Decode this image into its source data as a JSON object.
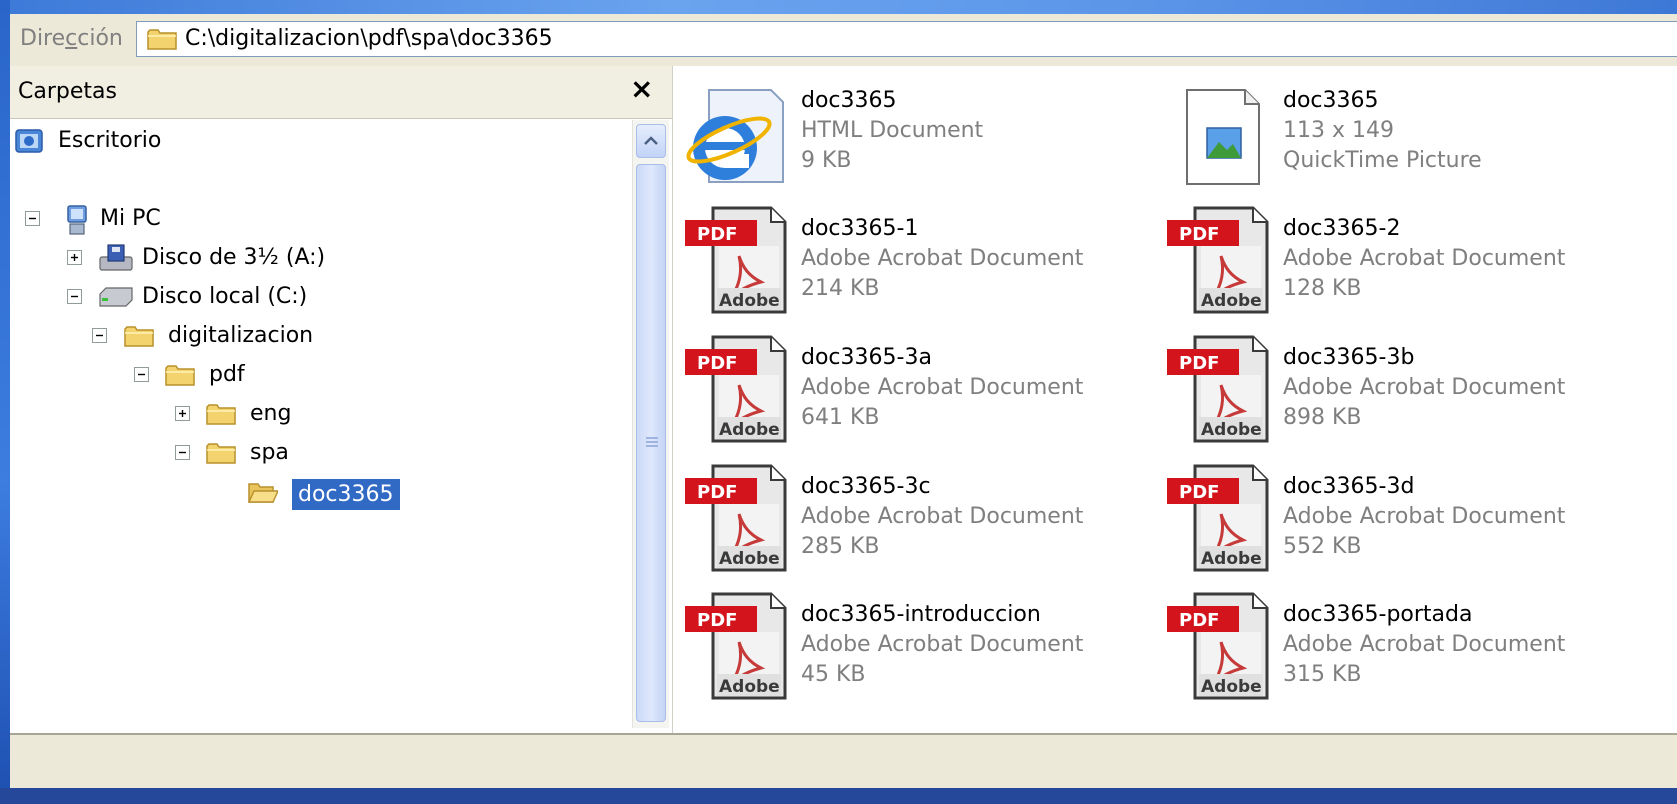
{
  "address_bar": {
    "label_prefix": "Dire",
    "label_underlined": "c",
    "label_suffix": "ción",
    "path": "C:\\digitalizacion\\pdf\\spa\\doc3365"
  },
  "folders_pane": {
    "title": "Carpetas",
    "close_glyph": "×",
    "tree": [
      {
        "label": "Escritorio",
        "icon": "desktop-icon"
      },
      {
        "label": "Mi PC",
        "icon": "my-computer-icon",
        "toggle": "collapse"
      },
      {
        "label": "Disco de 3½ (A:)",
        "icon": "floppy-drive-icon",
        "toggle": "expand"
      },
      {
        "label": "Disco local (C:)",
        "icon": "hard-drive-icon",
        "toggle": "collapse"
      },
      {
        "label": "digitalizacion",
        "icon": "folder-icon",
        "toggle": "collapse"
      },
      {
        "label": "pdf",
        "icon": "folder-icon",
        "toggle": "collapse"
      },
      {
        "label": "eng",
        "icon": "folder-icon",
        "toggle": "expand"
      },
      {
        "label": "spa",
        "icon": "folder-icon",
        "toggle": "collapse"
      },
      {
        "label": "doc3365",
        "icon": "folder-open-icon",
        "selected": true
      }
    ]
  },
  "files": [
    {
      "name": "doc3365",
      "line2": "HTML Document",
      "line3": "9 KB",
      "icon": "internet-explorer-html-icon"
    },
    {
      "name": "doc3365",
      "line2": "113 x 149",
      "line3": "QuickTime Picture",
      "icon": "image-file-icon"
    },
    {
      "name": "doc3365-1",
      "line2": "Adobe Acrobat Document",
      "line3": "214 KB",
      "icon": "pdf-icon"
    },
    {
      "name": "doc3365-2",
      "line2": "Adobe Acrobat Document",
      "line3": "128 KB",
      "icon": "pdf-icon"
    },
    {
      "name": "doc3365-3a",
      "line2": "Adobe Acrobat Document",
      "line3": "641 KB",
      "icon": "pdf-icon"
    },
    {
      "name": "doc3365-3b",
      "line2": "Adobe Acrobat Document",
      "line3": "898 KB",
      "icon": "pdf-icon"
    },
    {
      "name": "doc3365-3c",
      "line2": "Adobe Acrobat Document",
      "line3": "285 KB",
      "icon": "pdf-icon"
    },
    {
      "name": "doc3365-3d",
      "line2": "Adobe Acrobat Document",
      "line3": "552 KB",
      "icon": "pdf-icon"
    },
    {
      "name": "doc3365-introduccion",
      "line2": "Adobe Acrobat Document",
      "line3": "45 KB",
      "icon": "pdf-icon"
    },
    {
      "name": "doc3365-portada",
      "line2": "Adobe Acrobat Document",
      "line3": "315 KB",
      "icon": "pdf-icon"
    }
  ],
  "icon_text": {
    "pdf_badge": "PDF",
    "pdf_brand": "Adobe"
  },
  "colors": {
    "selection": "#316ac5",
    "window_frame": "#3d79d8",
    "pdf_red": "#d4141c",
    "folder_yellow": "#f3d36e"
  }
}
